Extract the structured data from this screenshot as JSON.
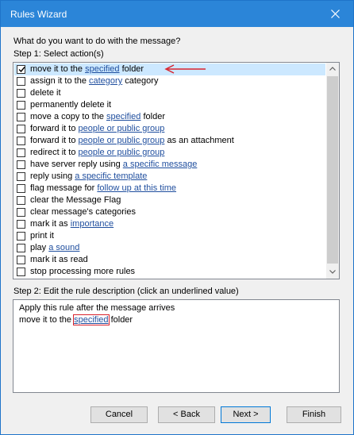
{
  "window": {
    "title": "Rules Wizard"
  },
  "prompt": "What do you want to do with the message?",
  "step1_label": "Step 1: Select action(s)",
  "actions": [
    {
      "checked": true,
      "selected": true,
      "parts": [
        "move it to the ",
        "specified",
        " folder"
      ]
    },
    {
      "checked": false,
      "parts": [
        "assign it to the ",
        "category",
        " category"
      ]
    },
    {
      "checked": false,
      "parts": [
        "delete it"
      ]
    },
    {
      "checked": false,
      "parts": [
        "permanently delete it"
      ]
    },
    {
      "checked": false,
      "parts": [
        "move a copy to the ",
        "specified",
        " folder"
      ]
    },
    {
      "checked": false,
      "parts": [
        "forward it to ",
        "people or public group"
      ]
    },
    {
      "checked": false,
      "parts": [
        "forward it to ",
        "people or public group",
        " as an attachment"
      ]
    },
    {
      "checked": false,
      "parts": [
        "redirect it to ",
        "people or public group"
      ]
    },
    {
      "checked": false,
      "parts": [
        "have server reply using ",
        "a specific message"
      ]
    },
    {
      "checked": false,
      "parts": [
        "reply using ",
        "a specific template"
      ]
    },
    {
      "checked": false,
      "parts": [
        "flag message for ",
        "follow up at this time"
      ]
    },
    {
      "checked": false,
      "parts": [
        "clear the Message Flag"
      ]
    },
    {
      "checked": false,
      "parts": [
        "clear message's categories"
      ]
    },
    {
      "checked": false,
      "parts": [
        "mark it as ",
        "importance"
      ]
    },
    {
      "checked": false,
      "parts": [
        "print it"
      ]
    },
    {
      "checked": false,
      "parts": [
        "play ",
        "a sound"
      ]
    },
    {
      "checked": false,
      "parts": [
        "mark it as read"
      ]
    },
    {
      "checked": false,
      "parts": [
        "stop processing more rules"
      ]
    }
  ],
  "step2_label": "Step 2: Edit the rule description (click an underlined value)",
  "description": {
    "line1": "Apply this rule after the message arrives",
    "line2_prefix": "move it to the ",
    "line2_link": "specified",
    "line2_suffix": " folder"
  },
  "buttons": {
    "cancel": "Cancel",
    "back": "< Back",
    "next": "Next >",
    "finish": "Finish"
  },
  "colors": {
    "titlebar": "#2b85d8",
    "link": "#1f4e9e",
    "selection": "#cce8ff",
    "annotation": "#d9232d"
  }
}
